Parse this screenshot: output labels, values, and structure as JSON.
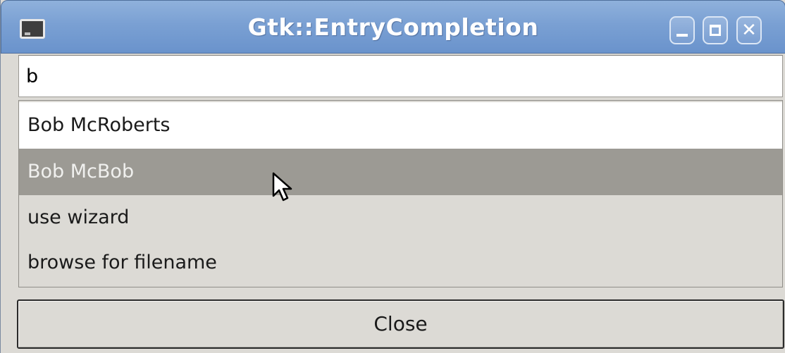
{
  "window": {
    "title": "Gtk::EntryCompletion",
    "icon": "app-window-icon",
    "controls": {
      "minimize_icon": "minimize-icon",
      "maximize_icon": "maximize-icon",
      "close_icon": "close-icon",
      "close_glyph": "✕"
    }
  },
  "entry": {
    "value": "b"
  },
  "completion": {
    "items": [
      {
        "label": "Bob McRoberts",
        "selected": false
      },
      {
        "label": "Bob McBob",
        "selected": true
      },
      {
        "label": "use wizard",
        "selected": false
      },
      {
        "label": "browse for filename",
        "selected": false
      }
    ]
  },
  "buttons": {
    "close_label": "Close"
  },
  "colors": {
    "titlebar": "#7aa0d3",
    "selection": "#9c9a94",
    "window_bg": "#dcdad5"
  }
}
